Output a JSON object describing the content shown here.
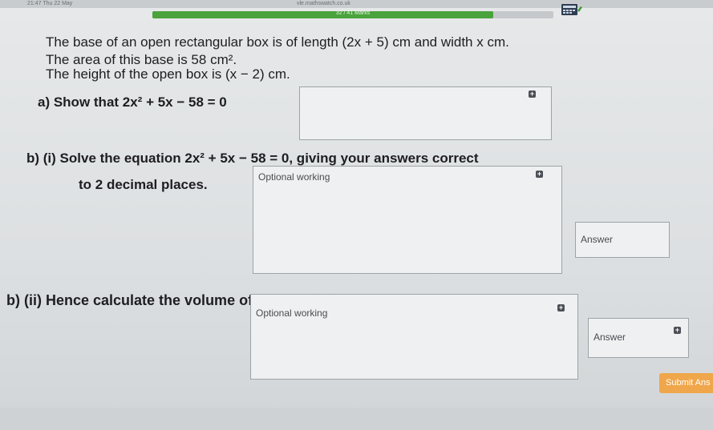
{
  "status_bar": {
    "time": "21:47  Thu 22 May",
    "url": "vle.mathswatch.co.uk"
  },
  "progress": {
    "text": "32 / 41 Marks",
    "fraction": 0.85
  },
  "question": {
    "intro_line1": "The base of an open rectangular box is of length (2x + 5) cm and width x cm.",
    "intro_line2": "The area of this base is 58 cm².",
    "intro_line3": "The height of the open box is (x − 2) cm.",
    "part_a": "a)  Show that 2x² + 5x − 58 = 0",
    "part_bi_line1": "b) (i)  Solve the equation 2x² + 5x − 58 = 0, giving your answers correct",
    "part_bi_line2": "to 2 decimal places.",
    "part_bii": "b) (ii)  Hence calculate the volume of the box, stating the units of your answer."
  },
  "labels": {
    "optional_working": "Optional working",
    "answer": "Answer",
    "submit": "Submit Ans"
  },
  "colors": {
    "progress": "#4aa33c",
    "submit": "#f0a64a"
  },
  "icons": {
    "calculator": "calculator-icon",
    "add": "plus-icon"
  }
}
